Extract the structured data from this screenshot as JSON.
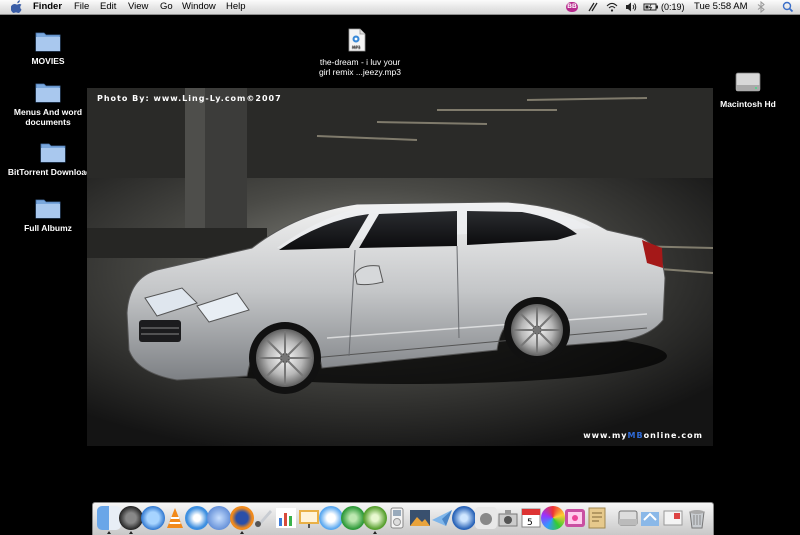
{
  "menubar": {
    "app_name": "Finder",
    "items": [
      "File",
      "Edit",
      "View",
      "Go",
      "Window",
      "Help"
    ],
    "user_badge": "BB",
    "battery": "(0:19)",
    "clock": "Tue 5:58 AM"
  },
  "desktop": {
    "icons": [
      {
        "label": "MOVIES"
      },
      {
        "label_lines": [
          "Menus And word",
          "documents"
        ]
      },
      {
        "label": "BitTorrent Downloads"
      },
      {
        "label": "Full Albumz"
      },
      {
        "label_lines": [
          "the-dream - i luv your",
          "girl remix ...jeezy.mp3"
        ]
      },
      {
        "label": "Macintosh Hd"
      }
    ]
  },
  "wallpaper": {
    "credit": "Photo By: www.Ling-Ly.com©2007",
    "site_prefix": "www.my",
    "site_accent": "MB",
    "site_suffix": "online.com"
  },
  "dock": {
    "items": [
      "finder-icon",
      "dashboard-icon",
      "itunes-icon",
      "vlc-icon",
      "safari-icon",
      "network-icon",
      "firefox-icon",
      "preview-icon",
      "chart-icon",
      "presentation-icon",
      "ichat-icon",
      "torrent-icon",
      "round-app-icon",
      "ipod-icon",
      "iphoto-icon",
      "mail-icon",
      "quicktime-icon",
      "apple-icon",
      "image-capture-icon",
      "ical-icon",
      "color-app-icon",
      "photo-app-icon",
      "notes-icon",
      "disk-icon",
      "stacks-icon",
      "mail-stamp-icon",
      "trash-icon"
    ]
  },
  "colors": {
    "menubar_bg": "#e8e8e8",
    "desktop_bg": "#000000",
    "folder_blue": "#8fb8e6",
    "dock_bg": "#d8d8d8",
    "badge_magenta": "#b72a8d",
    "site_blue": "#2f6bd8"
  }
}
